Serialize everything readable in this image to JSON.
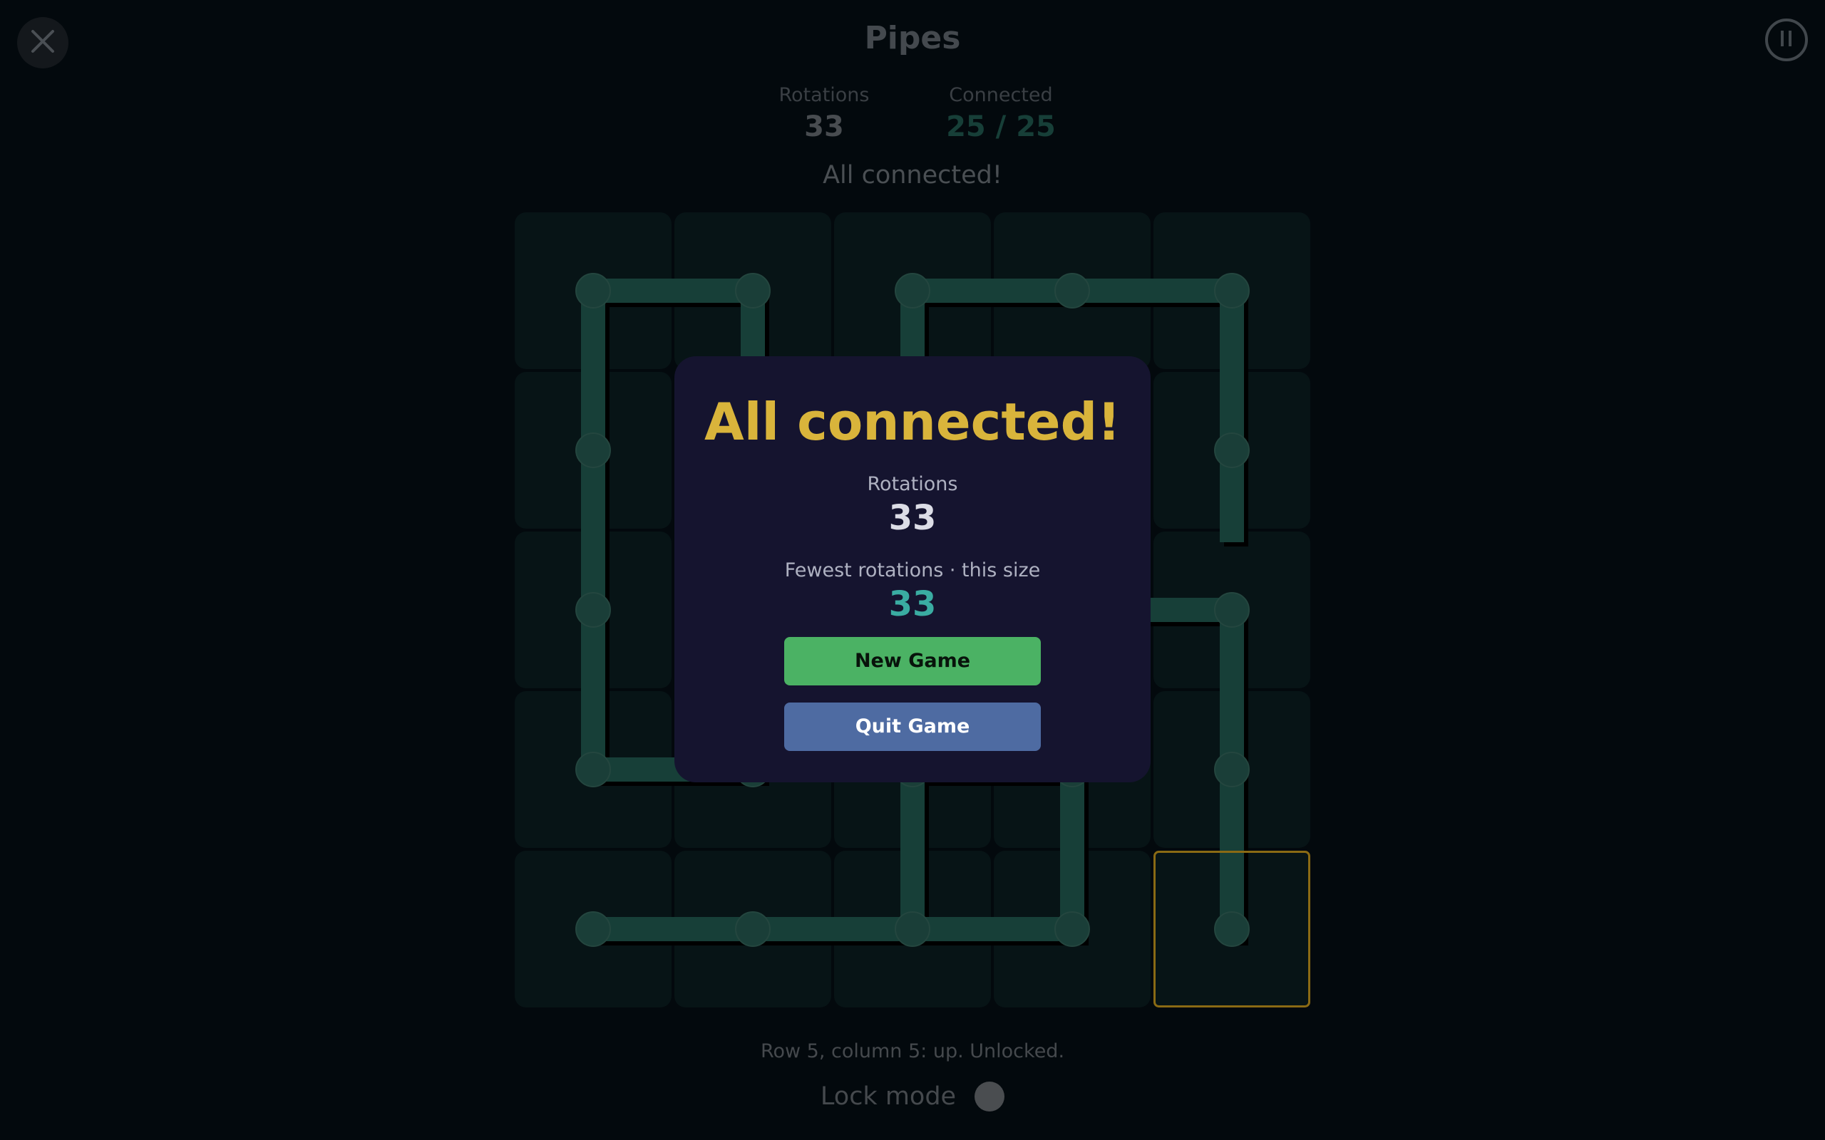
{
  "header": {
    "title": "Pipes",
    "close_icon": "close-icon",
    "pause_icon": "pause-icon"
  },
  "stats": {
    "rotations_label": "Rotations",
    "rotations_value": "33",
    "connected_label": "Connected",
    "connected_value": "25 / 25"
  },
  "status_text": "All connected!",
  "board": {
    "rows": 5,
    "cols": 5,
    "tiles": [
      [
        "RD",
        "LD",
        "RD",
        "LR",
        "LD"
      ],
      [
        "UD",
        "UD",
        "UD",
        "U",
        "UD"
      ],
      [
        "UD",
        "UD",
        "UD",
        "RD",
        "LD"
      ],
      [
        "UR",
        "LU",
        "RD",
        "LD",
        "UD"
      ],
      [
        "R",
        "LR",
        "LRU",
        "LU",
        "U"
      ]
    ],
    "selected": {
      "row": 5,
      "col": 5
    },
    "colors": {
      "tile": "#071416",
      "pipe": "#173f38",
      "node": "#1a3e38",
      "shadow": "#000000",
      "selected_outline": "#8a6a14"
    }
  },
  "cell_info": "Row 5, column 5: up. Unlocked.",
  "lock_mode": {
    "label": "Lock mode",
    "enabled": false
  },
  "modal": {
    "title": "All connected!",
    "rotations_label": "Rotations",
    "rotations_value": "33",
    "best_label": "Fewest rotations · this size",
    "best_value": "33",
    "new_game_label": "New Game",
    "quit_game_label": "Quit Game",
    "colors": {
      "title": "#d9b43b",
      "best_value": "#3aaca2",
      "new_game": "#4bb264",
      "quit_game": "#4e6ba2"
    }
  }
}
